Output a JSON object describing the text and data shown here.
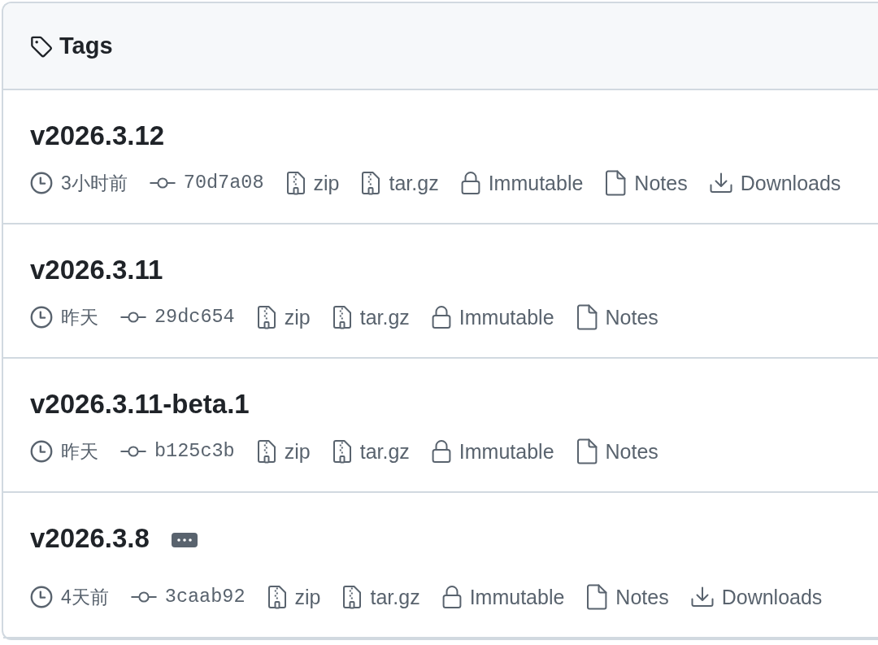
{
  "header": {
    "title": "Tags"
  },
  "tags": [
    {
      "name": "v2026.3.12",
      "expandable": false,
      "meta": [
        {
          "kind": "time",
          "text": "3小时前"
        },
        {
          "kind": "commit",
          "text": "70d7a08"
        },
        {
          "kind": "zip",
          "text": "zip"
        },
        {
          "kind": "targz",
          "text": "tar.gz"
        },
        {
          "kind": "immutable",
          "text": "Immutable"
        },
        {
          "kind": "notes",
          "text": "Notes"
        },
        {
          "kind": "downloads",
          "text": "Downloads"
        }
      ]
    },
    {
      "name": "v2026.3.11",
      "expandable": false,
      "meta": [
        {
          "kind": "time",
          "text": "昨天"
        },
        {
          "kind": "commit",
          "text": "29dc654"
        },
        {
          "kind": "zip",
          "text": "zip"
        },
        {
          "kind": "targz",
          "text": "tar.gz"
        },
        {
          "kind": "immutable",
          "text": "Immutable"
        },
        {
          "kind": "notes",
          "text": "Notes"
        }
      ]
    },
    {
      "name": "v2026.3.11-beta.1",
      "expandable": false,
      "meta": [
        {
          "kind": "time",
          "text": "昨天"
        },
        {
          "kind": "commit",
          "text": "b125c3b"
        },
        {
          "kind": "zip",
          "text": "zip"
        },
        {
          "kind": "targz",
          "text": "tar.gz"
        },
        {
          "kind": "immutable",
          "text": "Immutable"
        },
        {
          "kind": "notes",
          "text": "Notes"
        }
      ]
    },
    {
      "name": "v2026.3.8",
      "expandable": true,
      "meta": [
        {
          "kind": "time",
          "text": "4天前"
        },
        {
          "kind": "commit",
          "text": "3caab92"
        },
        {
          "kind": "zip",
          "text": "zip"
        },
        {
          "kind": "targz",
          "text": "tar.gz"
        },
        {
          "kind": "immutable",
          "text": "Immutable"
        },
        {
          "kind": "notes",
          "text": "Notes"
        },
        {
          "kind": "downloads",
          "text": "Downloads"
        }
      ]
    }
  ]
}
